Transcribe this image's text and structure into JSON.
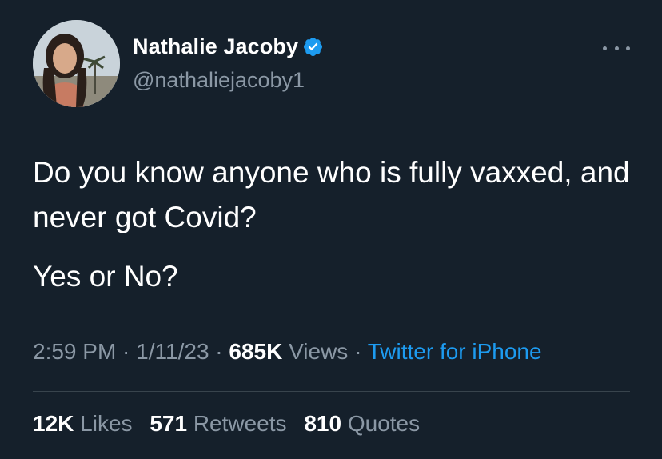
{
  "author": {
    "name": "Nathalie Jacoby",
    "handle": "@nathaliejacoby1",
    "verified_icon": "verified-badge-icon",
    "verified_color": "#1d9bf0"
  },
  "tweet": {
    "lines": [
      "Do you know anyone who is fully vaxxed, and never got Covid?",
      "Yes or No?"
    ]
  },
  "meta": {
    "time": "2:59 PM",
    "sep1": " · ",
    "date": "1/11/23",
    "sep2": " · ",
    "views_count": "685K",
    "views_label": " Views",
    "sep3": " · ",
    "source": "Twitter for iPhone"
  },
  "stats": {
    "likes_count": "12K",
    "likes_label": "Likes",
    "retweets_count": "571",
    "retweets_label": "Retweets",
    "quotes_count": "810",
    "quotes_label": "Quotes"
  },
  "colors": {
    "background": "#15202b",
    "text_primary": "#ffffff",
    "text_secondary": "#8b98a5",
    "link": "#1d9bf0",
    "divider": "#38444d"
  }
}
